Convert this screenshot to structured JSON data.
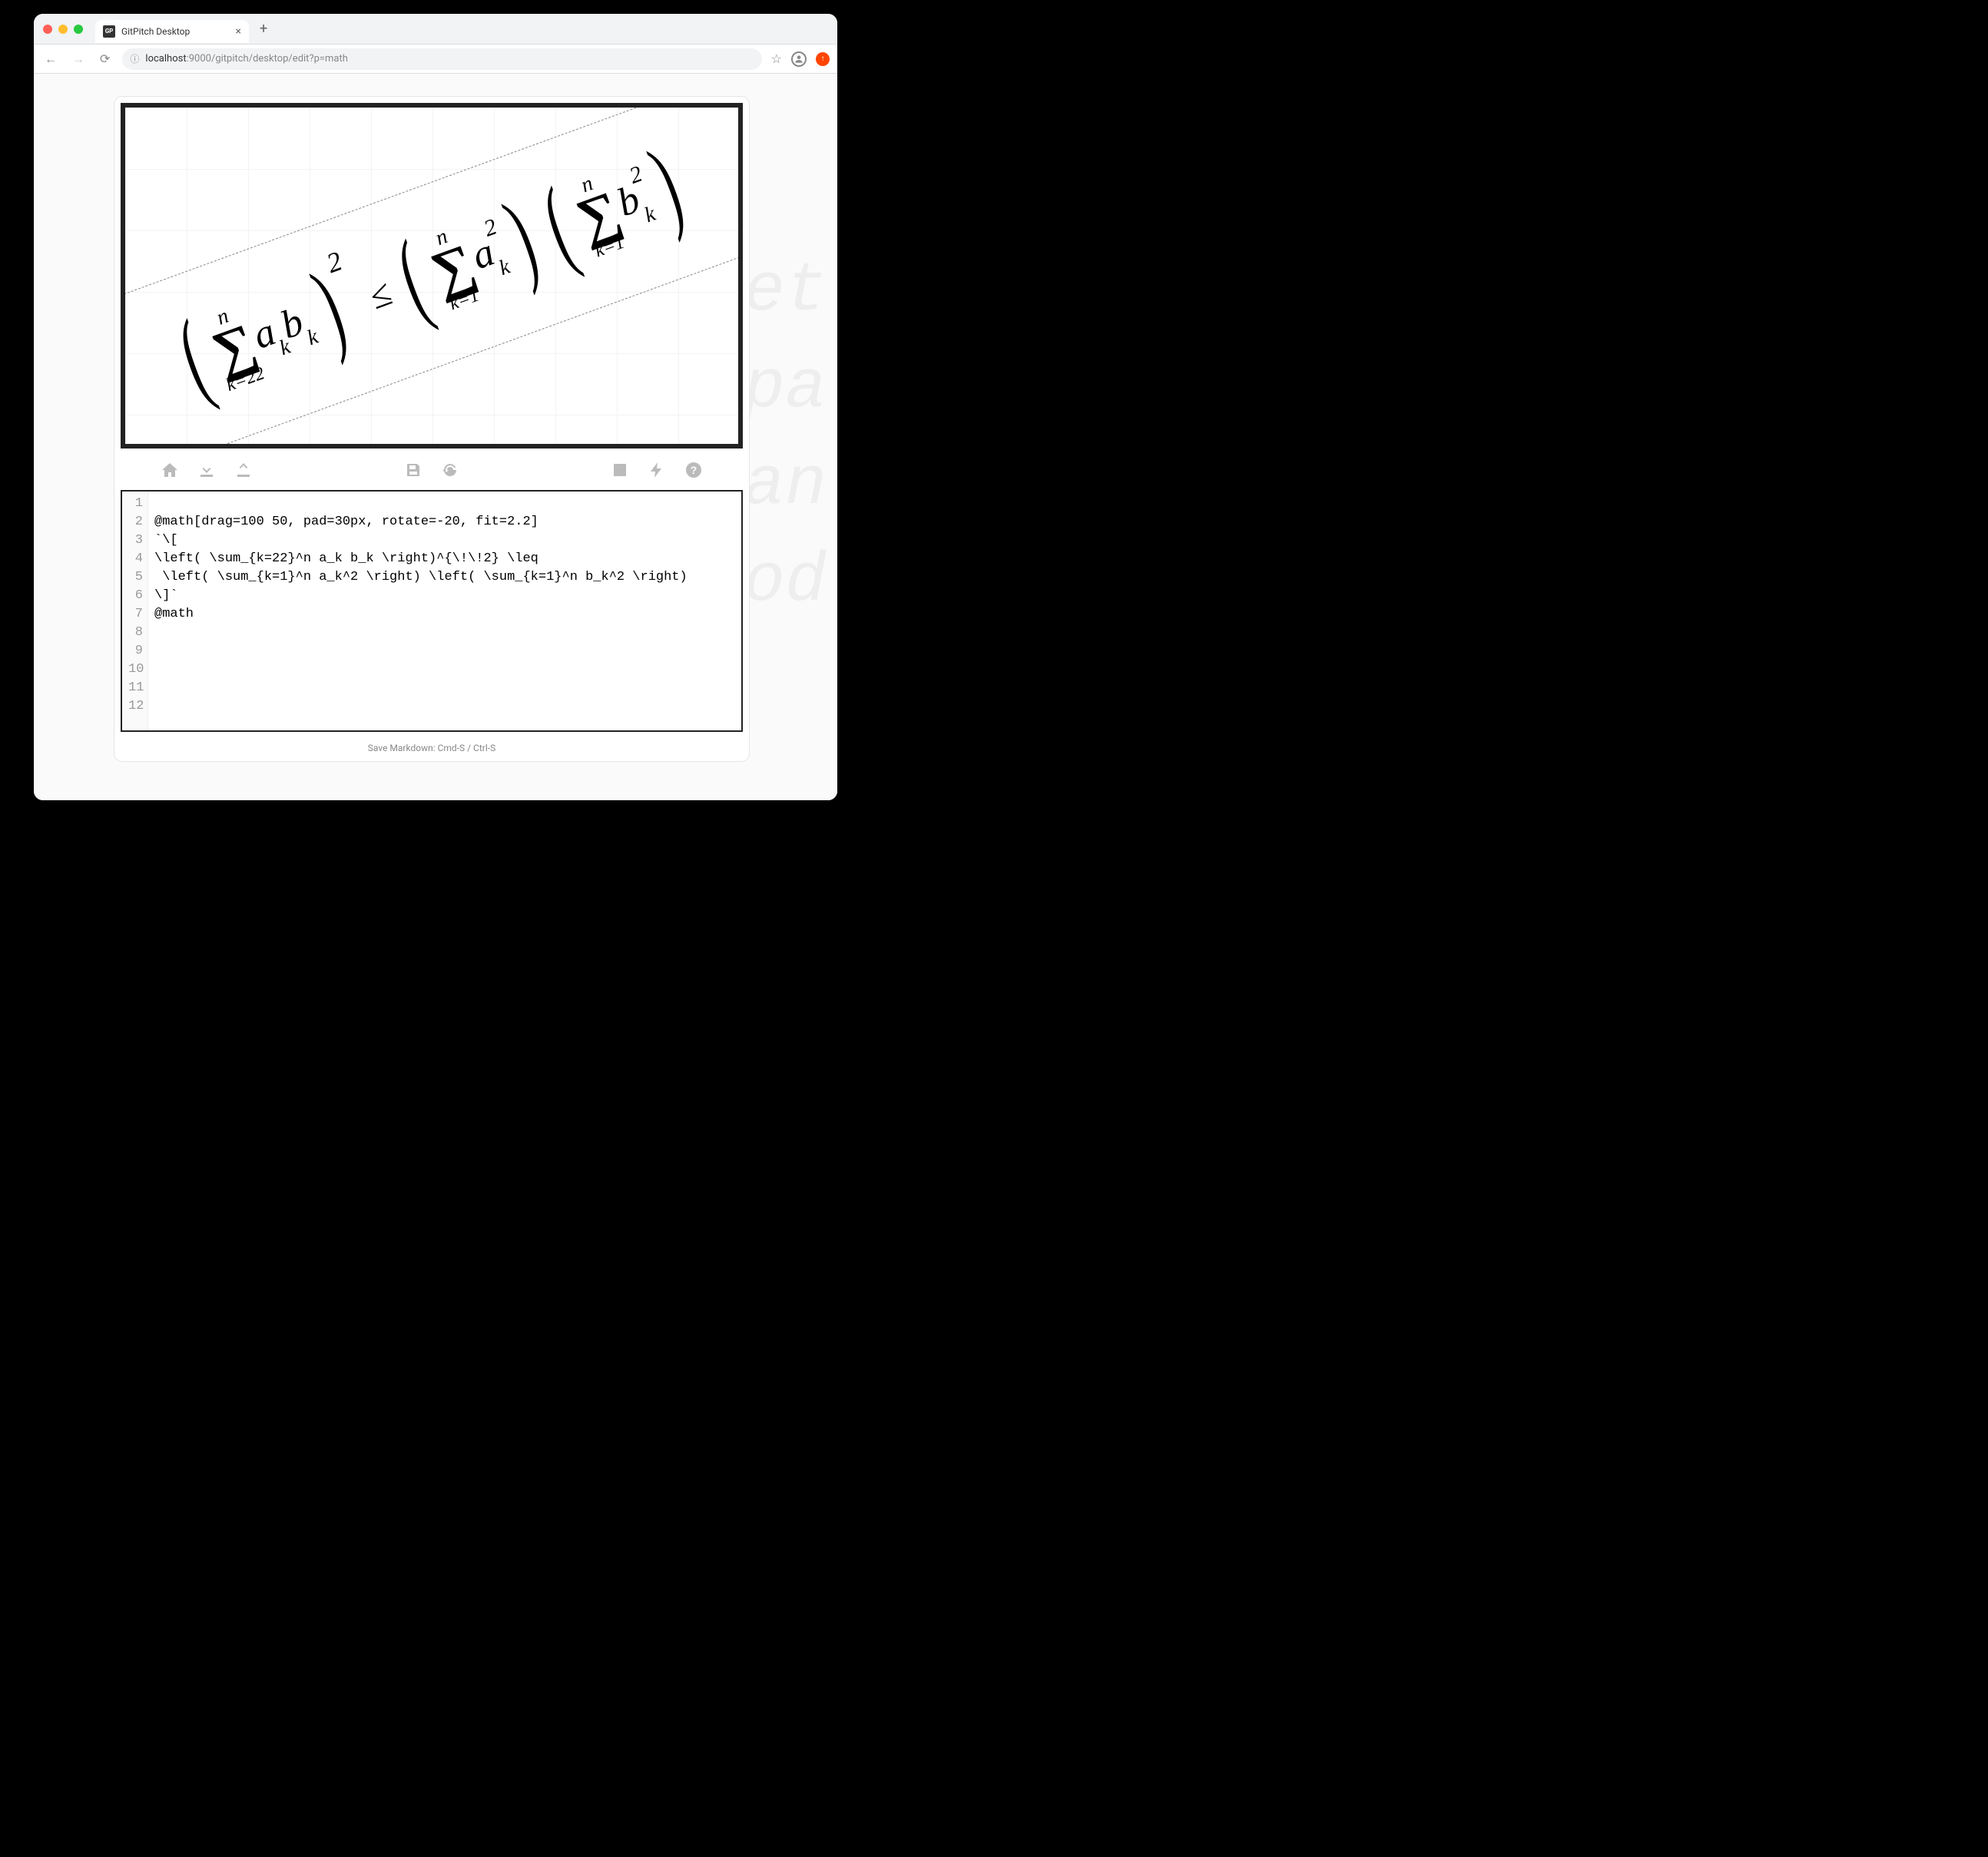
{
  "browser": {
    "tab_title": "GitPitch Desktop",
    "tab_favicon_text": "GP",
    "url_display_prefix": "localhost",
    "url_display_rest": ":9000/gitpitch/desktop/edit?p=math"
  },
  "background_snippet_lines": [
    "et",
    "pa",
    "an",
    "od("
  ],
  "preview": {
    "rotate_deg": -20,
    "sigma1": {
      "upper": "n",
      "lower": "k=22"
    },
    "term1": {
      "a": "a",
      "a_sub": "k",
      "b": "b",
      "b_sub": "k"
    },
    "group1_exp": "2",
    "leq": "≤",
    "sigma2": {
      "upper": "n",
      "lower": "k=1"
    },
    "term2": {
      "base": "a",
      "sup": "2",
      "sub": "k"
    },
    "sigma3": {
      "upper": "n",
      "lower": "k=1"
    },
    "term3": {
      "base": "b",
      "sup": "2",
      "sub": "k"
    }
  },
  "toolbar": {
    "home": "Home",
    "download": "Download",
    "upload": "Upload",
    "save": "Save",
    "refresh": "Refresh",
    "image": "Image",
    "bolt": "Bolt",
    "help": "Help"
  },
  "editor": {
    "line_count": 12,
    "lines": [
      "",
      "@math[drag=100 50, pad=30px, rotate=-20, fit=2.2]",
      "`\\[",
      "\\left( \\sum_{k=22}^n a_k b_k \\right)^{\\!\\!2} \\leq",
      " \\left( \\sum_{k=1}^n a_k^2 \\right) \\left( \\sum_{k=1}^n b_k^2 \\right)",
      "\\]`",
      "@math",
      "",
      "",
      "",
      "",
      ""
    ]
  },
  "footer": {
    "hint": "Save Markdown: Cmd-S / Ctrl-S"
  }
}
